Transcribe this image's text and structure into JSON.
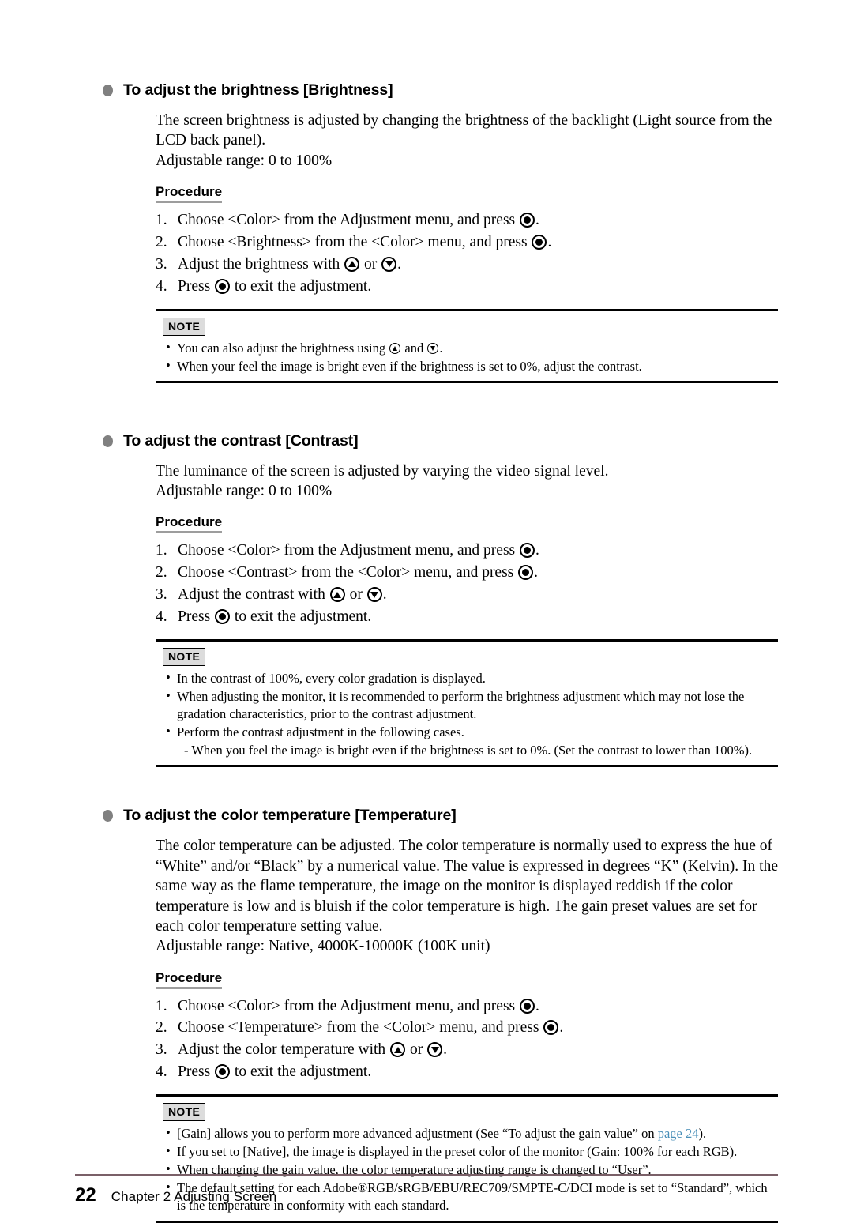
{
  "document": {
    "page_number": "22",
    "footer_text": "Chapter 2  Adjusting Screen",
    "link_color": "#4a8fb8",
    "rule_color": "#7a6068",
    "bullet_color": "#808080"
  },
  "sections": [
    {
      "id": "brightness",
      "heading": "To adjust the brightness [Brightness]",
      "body": [
        "The screen brightness is adjusted by changing the brightness of the backlight (Light source from the LCD back panel).",
        "Adjustable range: 0 to 100%"
      ],
      "procedure": {
        "label": "Procedure",
        "steps": [
          {
            "num": "1.",
            "pre": "Choose <Color> from the Adjustment menu, and press ",
            "icon": "enter-button-icon",
            "post": "."
          },
          {
            "num": "2.",
            "pre": "Choose <Brightness> from the <Color> menu, and press ",
            "icon": "enter-button-icon",
            "post": "."
          },
          {
            "num": "3.",
            "pre": "Adjust the brightness with ",
            "icon": "up-button-icon",
            "mid": " or ",
            "icon2": "down-button-icon",
            "post": "."
          },
          {
            "num": "4.",
            "pre": "Press ",
            "icon": "enter-button-icon",
            "post": " to exit the adjustment."
          }
        ]
      },
      "note": {
        "badge": "NOTE",
        "items": [
          {
            "kind": "icons",
            "pre": "You can also adjust the brightness using ",
            "icon": "up-button-icon",
            "mid": " and ",
            "icon2": "down-button-icon",
            "post": "."
          },
          {
            "kind": "text",
            "text": "When your feel the image is bright even if the brightness is set to 0%, adjust the contrast."
          }
        ]
      }
    },
    {
      "id": "contrast",
      "heading": "To adjust the contrast [Contrast]",
      "body": [
        "The luminance of the screen is adjusted by varying the video signal level.",
        "Adjustable range: 0 to 100%"
      ],
      "procedure": {
        "label": "Procedure",
        "steps": [
          {
            "num": "1.",
            "pre": "Choose <Color> from the Adjustment menu, and press ",
            "icon": "enter-button-icon",
            "post": "."
          },
          {
            "num": "2.",
            "pre": "Choose <Contrast> from the <Color> menu, and press ",
            "icon": "enter-button-icon",
            "post": "."
          },
          {
            "num": "3.",
            "pre": "Adjust the contrast with ",
            "icon": "up-button-icon",
            "mid": " or ",
            "icon2": "down-button-icon",
            "post": "."
          },
          {
            "num": "4.",
            "pre": "Press ",
            "icon": "enter-button-icon",
            "post": " to exit the adjustment."
          }
        ]
      },
      "note": {
        "badge": "NOTE",
        "items": [
          {
            "kind": "text",
            "text": "In the contrast of 100%, every color gradation is displayed."
          },
          {
            "kind": "text",
            "text": "When adjusting the monitor, it is recommended to perform the brightness adjustment which may not lose the gradation characteristics, prior to the contrast adjustment."
          },
          {
            "kind": "text",
            "text": "Perform the contrast adjustment in the following cases."
          },
          {
            "kind": "sub",
            "text": "- When you feel the image is bright even if the brightness is set to 0%. (Set the contrast to lower than 100%)."
          }
        ]
      }
    },
    {
      "id": "temperature",
      "heading": "To adjust the color temperature [Temperature]",
      "body": [
        "The color temperature can be adjusted. The color temperature is normally used to express the hue of “White” and/or “Black” by a numerical value. The value is expressed in degrees “K” (Kelvin). In the same way as the flame temperature, the image on the monitor is displayed reddish if the color temperature is low and is bluish if the color temperature is high. The gain preset values are set for each color temperature setting value.",
        "Adjustable range: Native, 4000K-10000K (100K unit)"
      ],
      "procedure": {
        "label": "Procedure",
        "steps": [
          {
            "num": "1.",
            "pre": "Choose <Color> from the Adjustment menu, and press ",
            "icon": "enter-button-icon",
            "post": "."
          },
          {
            "num": "2.",
            "pre": "Choose <Temperature> from the <Color> menu, and press ",
            "icon": "enter-button-icon",
            "post": "."
          },
          {
            "num": "3.",
            "pre": "Adjust the color temperature with ",
            "icon": "up-button-icon",
            "mid": " or ",
            "icon2": "down-button-icon",
            "post": "."
          },
          {
            "num": "4.",
            "pre": "Press ",
            "icon": "enter-button-icon",
            "post": " to exit the adjustment."
          }
        ]
      },
      "note": {
        "badge": "NOTE",
        "items": [
          {
            "kind": "link",
            "pre": "[Gain] allows you to perform more advanced adjustment (See “To adjust the gain value” on ",
            "link": "page 24",
            "post": ")."
          },
          {
            "kind": "text",
            "text": "If you set to [Native], the image is displayed in the preset color of the monitor (Gain: 100% for each RGB)."
          },
          {
            "kind": "text",
            "text": "When changing the gain value, the color temperature adjusting range is changed to “User”."
          },
          {
            "kind": "text",
            "text": "The default setting for each Adobe®RGB/sRGB/EBU/REC709/SMPTE-C/DCI mode is set to “Standard”, which is the temperature in conformity with each standard."
          }
        ]
      }
    }
  ]
}
